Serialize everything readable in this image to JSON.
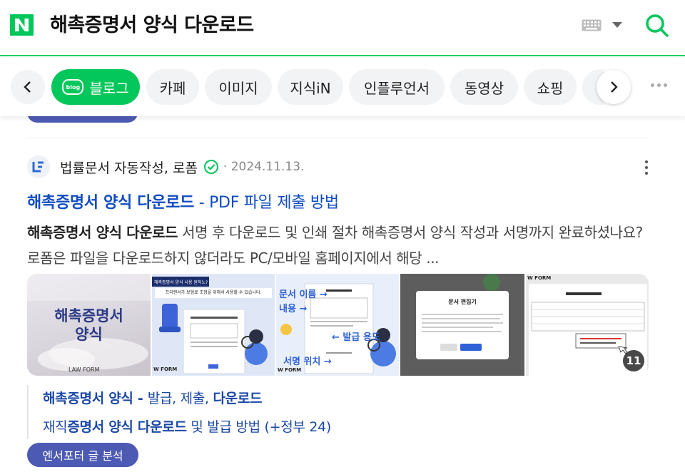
{
  "header": {
    "query": "해촉증명서 양식 다운로드",
    "logo_letter": "N",
    "keyboard_icon": "keyboard-icon",
    "search_icon": "search-icon",
    "brand_color": "#03c75a"
  },
  "tabs": {
    "items": [
      {
        "label": "블로그",
        "badge": "blog",
        "active": true
      },
      {
        "label": "카페"
      },
      {
        "label": "이미지"
      },
      {
        "label": "지식iN"
      },
      {
        "label": "인플루언서"
      },
      {
        "label": "동영상"
      },
      {
        "label": "쇼핑"
      }
    ]
  },
  "result": {
    "source_name": "법률문서 자동작성, 로폼",
    "date": "· 2024.11.13.",
    "title_bold": "해촉증명서 양식 다운로드",
    "title_rest": " - PDF 파일 제출 방법",
    "desc_bold": "해촉증명서 양식 다운로드",
    "desc_rest": " 서명 후 다운로드 및 인쇄 절차 해촉증명서 양식 작성과 서명까지 완료하셨나요? 로폼은 파일을 다운로드하지 않더라도 PC/모바일 홈페이지에서 해당 ...",
    "thumbnails": {
      "t1_title_line1": "해촉증명서",
      "t1_title_line2": "양식",
      "t1_footer": "LAW FORM",
      "t2_top": "해촉증명서 양식 사용 원칙노?",
      "t2_sub": "프리랜서가 보험료 조정을 위해서 사용할 수 있습니다.",
      "t2_footer": "W FORM",
      "t3_label1": "문서 이름 →",
      "t3_label2": "내용 →",
      "t3_label3": "← 발급 용도",
      "t3_label4": "서명 위치 →",
      "t3_footer": "W FORM",
      "t4_dialog_title": "문서 편집기",
      "t5_header": "W FORM",
      "more_count": "11"
    },
    "sublinks": [
      {
        "bold": "해촉증명서 양식",
        "sep": " - ",
        "rest1": "발급, 제출, ",
        "bold2": "다운로드"
      },
      {
        "pre": "재직",
        "bold": "증명서 양식 다운로드",
        "rest": " 및 발급 방법 (+정부 24)"
      }
    ],
    "analysis_label": "엔서포터 글 분석"
  }
}
